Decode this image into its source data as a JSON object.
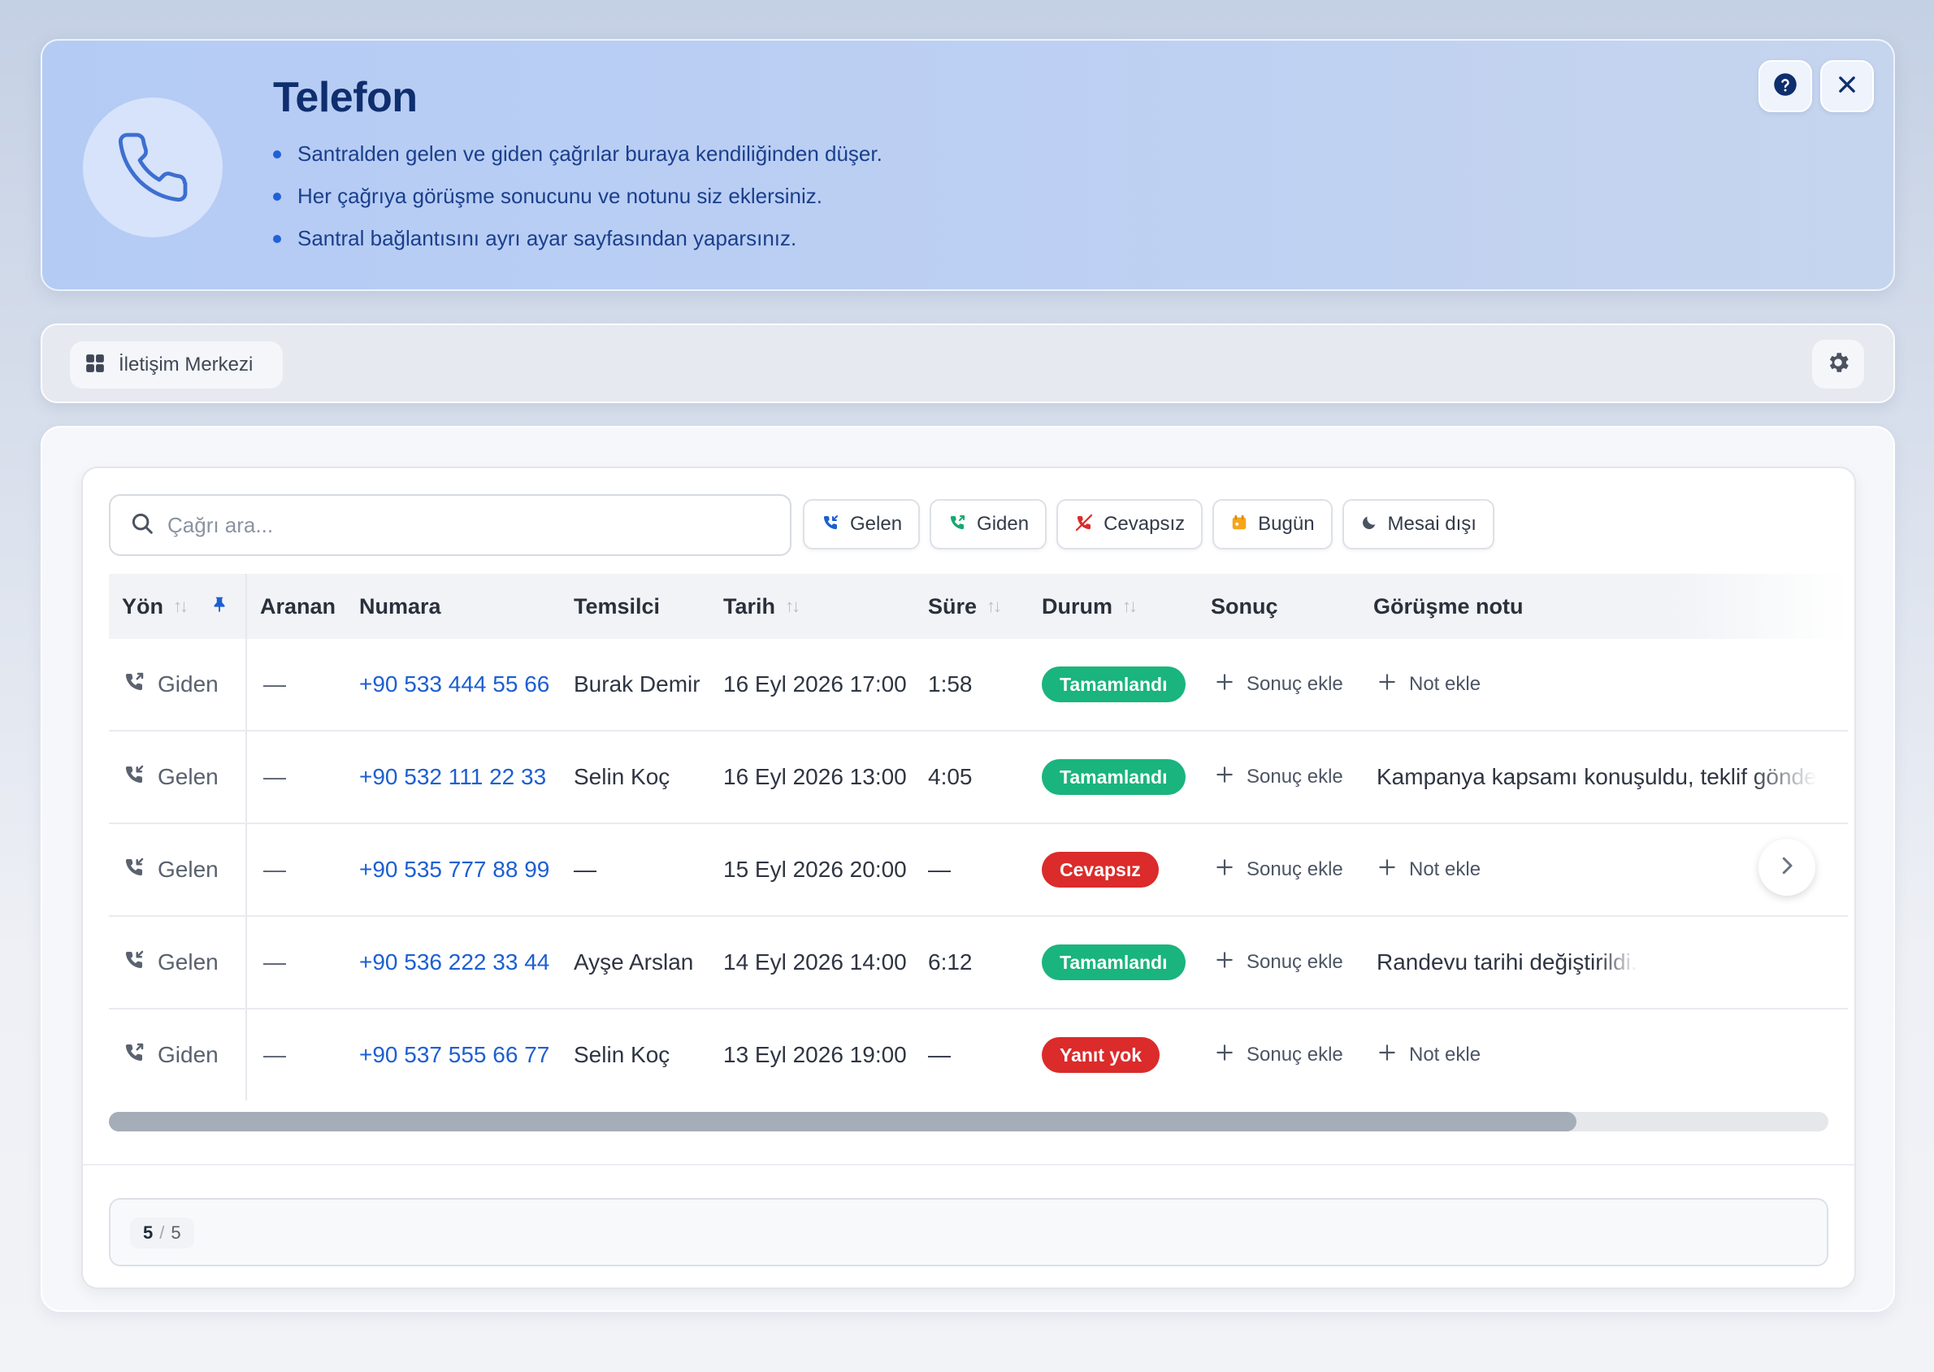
{
  "hero": {
    "title": "Telefon",
    "bullets": [
      "Santralden gelen ve giden çağrılar buraya kendiliğinden düşer.",
      "Her çağrıya görüşme sonucunu ve notunu siz eklersiniz.",
      "Santral bağlantısını ayrı ayar sayfasından yaparsınız."
    ],
    "icon": "phone-icon",
    "help_icon": "help-circle-icon",
    "close_icon": "close-icon"
  },
  "toolbar": {
    "breadcrumb_label": "İletişim Merkezi",
    "breadcrumb_icon": "grid-icon",
    "settings_icon": "gear-icon"
  },
  "search": {
    "placeholder": "Çağrı ara...",
    "value": ""
  },
  "filters": [
    {
      "label": "Gelen",
      "icon": "incoming-call-icon"
    },
    {
      "label": "Giden",
      "icon": "outgoing-call-icon"
    },
    {
      "label": "Cevapsız",
      "icon": "missed-call-icon"
    },
    {
      "label": "Bugün",
      "icon": "calendar-icon"
    },
    {
      "label": "Mesai dışı",
      "icon": "moon-icon"
    }
  ],
  "table": {
    "columns": [
      "Yön",
      "Aranan",
      "Numara",
      "Temsilci",
      "Tarih",
      "Süre",
      "Durum",
      "Sonuç",
      "Görüşme notu"
    ],
    "rows": [
      {
        "direction": "Giden",
        "called": "—",
        "number": "+90 533 444 55 66",
        "agent": "Burak Demir",
        "date": "16 Eyl 2026 17:00",
        "duration": "1:58",
        "status": "Tamamlandı",
        "status_kind": "ok",
        "result": "Sonuç ekle",
        "note": "Not ekle",
        "note_is_action": true
      },
      {
        "direction": "Gelen",
        "called": "—",
        "number": "+90 532 111 22 33",
        "agent": "Selin Koç",
        "date": "16 Eyl 2026 13:00",
        "duration": "4:05",
        "status": "Tamamlandı",
        "status_kind": "ok",
        "result": "Sonuç ekle",
        "note": "Kampanya kapsamı konuşuldu, teklif gönde",
        "note_is_action": false
      },
      {
        "direction": "Gelen",
        "called": "—",
        "number": "+90 535 777 88 99",
        "agent": "—",
        "date": "15 Eyl 2026 20:00",
        "duration": "—",
        "status": "Cevapsız",
        "status_kind": "bad",
        "result": "Sonuç ekle",
        "note": "Not ekle",
        "note_is_action": true
      },
      {
        "direction": "Gelen",
        "called": "—",
        "number": "+90 536 222 33 44",
        "agent": "Ayşe Arslan",
        "date": "14 Eyl 2026 14:00",
        "duration": "6:12",
        "status": "Tamamlandı",
        "status_kind": "ok",
        "result": "Sonuç ekle",
        "note": "Randevu tarihi değiştirildi.",
        "note_is_action": false
      },
      {
        "direction": "Giden",
        "called": "—",
        "number": "+90 537 555 66 77",
        "agent": "Selin Koç",
        "date": "13 Eyl 2026 19:00",
        "duration": "—",
        "status": "Yanıt yok",
        "status_kind": "bad",
        "result": "Sonuç ekle",
        "note": "Not ekle",
        "note_is_action": true
      }
    ]
  },
  "pagination": {
    "shown": "5",
    "separator": "/",
    "total": "5"
  },
  "colors": {
    "accent": "#1d5fd1",
    "success": "#1ab47e",
    "danger": "#db2b2b"
  }
}
